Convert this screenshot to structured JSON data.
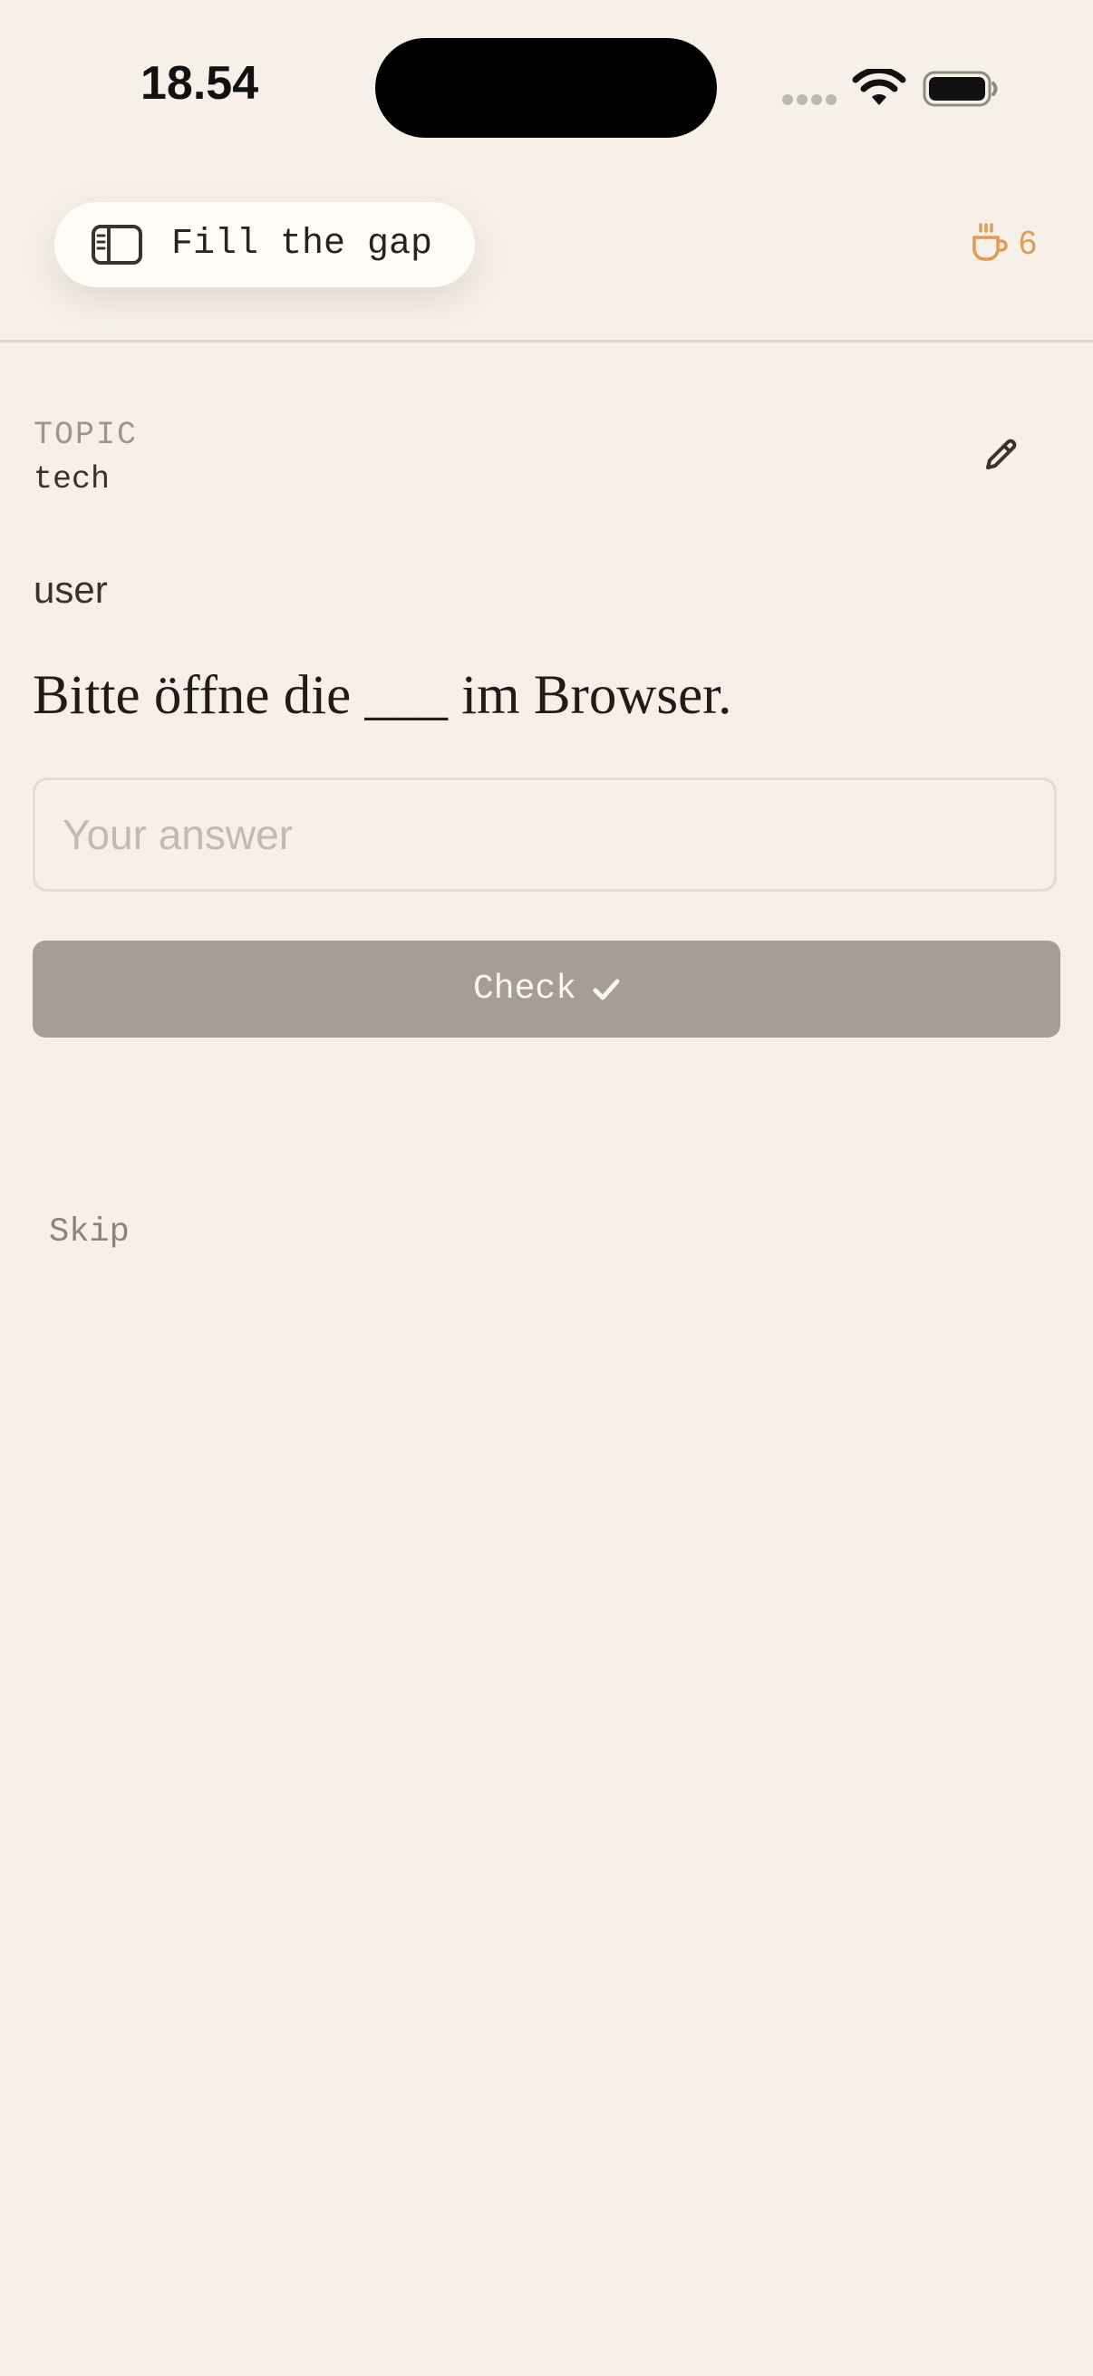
{
  "status_bar": {
    "time": "18.54",
    "icons": [
      "signal-dots-icon",
      "wifi-icon",
      "battery-icon"
    ]
  },
  "header": {
    "mode_label": "Fill the gap",
    "mode_icon": "sidebar-toggle-icon",
    "streak_icon": "coffee-cup-icon",
    "streak_count": "6"
  },
  "topic": {
    "caption": "TOPIC",
    "value": "tech",
    "edit_icon": "pencil-icon"
  },
  "exercise": {
    "speaker": "user",
    "sentence": "Bitte öffne die ___ im Browser.",
    "answer_value": "",
    "answer_placeholder": "Your answer",
    "check_label": "Check",
    "check_icon": "checkmark-icon",
    "skip_label": "Skip"
  },
  "colors": {
    "background": "#f6f0e9",
    "accent_orange": "#e39a52",
    "check_button": "#a69e94",
    "text_dark": "#231c15",
    "text_muted": "#9d968e"
  }
}
